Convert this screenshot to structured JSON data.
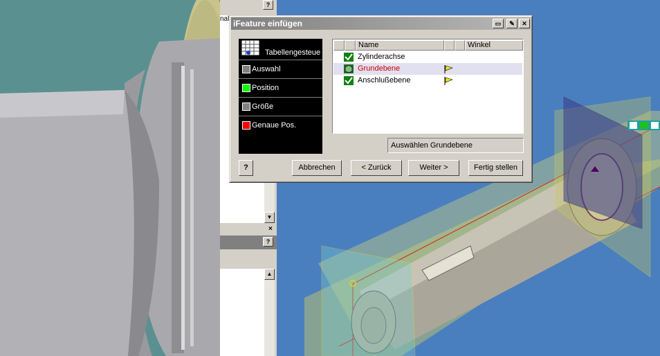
{
  "dialog": {
    "title": "iFeature einfügen",
    "steps": [
      {
        "label": "Tabellengesteue"
      },
      {
        "label": "Auswahl",
        "color": "#808080"
      },
      {
        "label": "Position",
        "color": "#00ff00"
      },
      {
        "label": "Größe",
        "color": "#808080"
      },
      {
        "label": "Genaue Pos.",
        "color": "#ff0000"
      }
    ],
    "columns": {
      "name": "Name",
      "angle": "Winkel"
    },
    "rows": [
      {
        "name": "Zylinderachse",
        "selected": false
      },
      {
        "name": "Grundebene",
        "selected": true
      },
      {
        "name": "Anschlußebene",
        "selected": false
      }
    ],
    "status": "Auswählen Grundebene",
    "buttons": {
      "help": "?",
      "cancel": "Abbrechen",
      "back": "< Zurück",
      "next": "Weiter >",
      "finish": "Fertig stellen"
    },
    "colors": {
      "selected_text": "#cc0000",
      "selected_bg": "#e0e0f0"
    }
  },
  "side_panel": {
    "partial_text": "nalt",
    "help": "?"
  }
}
